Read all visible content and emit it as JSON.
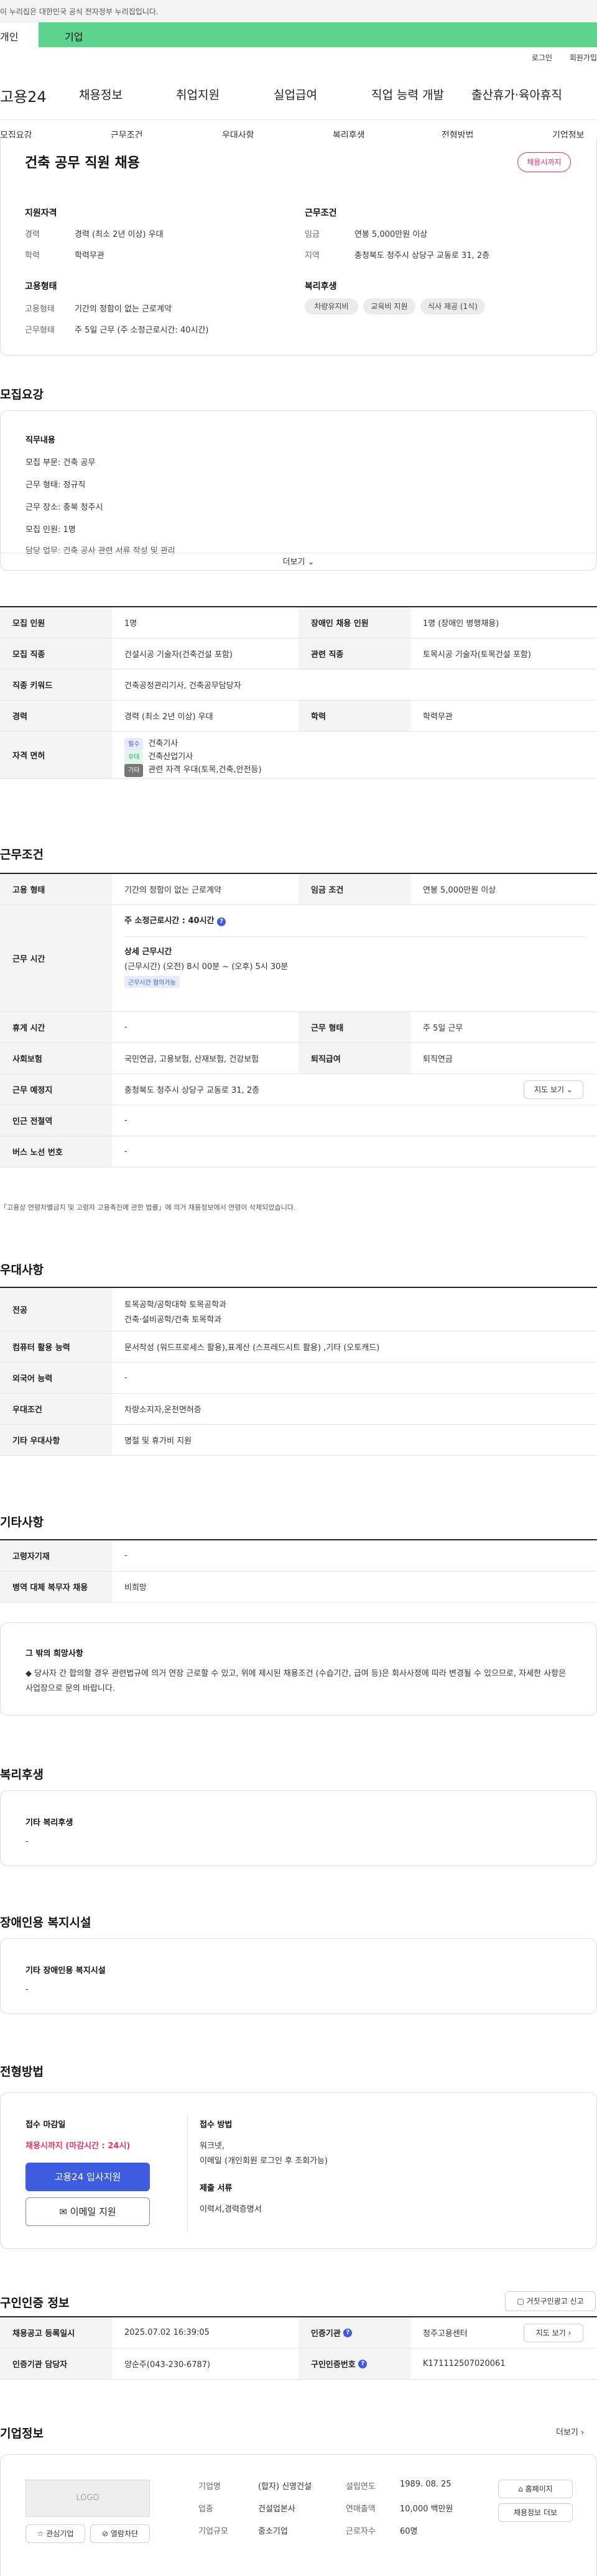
{
  "gov_banner": "이 누리집은 대한민국 공식 전자정부 누리집입니다.",
  "top_tabs": {
    "tab1": "개인",
    "tab2": "기업"
  },
  "util": {
    "login": "로그인",
    "join": "회원가입"
  },
  "header": {
    "brand": "고용24",
    "gnb": [
      "채용정보",
      "취업지원",
      "실업급여",
      "직업 능력 개발",
      "출산휴가·육아휴직"
    ]
  },
  "subnav": [
    "모집요강",
    "근무조건",
    "우대사항",
    "복리후생",
    "전형방법",
    "기업정보"
  ],
  "job": {
    "title": "건축 공무 직원 채용",
    "badge": "채용시까지",
    "qual": {
      "heading": "지원자격",
      "career_label": "경력",
      "career": "경력 (최소 2년 이상) 우대",
      "edu_label": "학력",
      "edu": "학력무관"
    },
    "cond": {
      "heading": "근무조건",
      "wage_label": "임금",
      "wage": "연봉 5,000만원 이상",
      "loc_label": "지역",
      "loc": "충청북도 청주시 상당구 교동로 31, 2층"
    },
    "emp": {
      "heading": "고용형태",
      "type_label": "고용형태",
      "type": "기간의 정함이 없는 근로계약",
      "hours_label": "근무형태",
      "hours": "주 5일 근무 (주 소정근로시간: 40시간)"
    },
    "welfare": {
      "heading": "복리후생",
      "chips": [
        "차량유지비",
        "교육비 지원",
        "식사 제공 (1식)"
      ]
    }
  },
  "recruit": {
    "title": "모집요강",
    "duty_heading": "직무내용",
    "lines": [
      "모집 부문: 건축 공무",
      "근무 형태: 정규직",
      "근무 장소: 충북 청주시",
      "모집 인원: 1명",
      "담당 업무: 건축 공사 관련 서류 작성 및 관리"
    ],
    "more": "더보기"
  },
  "recruit_table": {
    "count_label": "모집 인원",
    "count": "1명",
    "disabled_label": "장애인 채용 인원",
    "disabled": "1명 (장애인 병행채용)",
    "job_label": "모집 직종",
    "job": "건설시공 기술자(건축건설 포함)",
    "related_label": "관련 직종",
    "related": "토목시공 기술자(토목건설 포함)",
    "keyword_label": "직종 키워드",
    "keyword": "건축공정관리기사, 건축공무담당자",
    "career_label": "경력",
    "career": "경력 (최소 2년 이상) 우대",
    "edu_label": "학력",
    "edu": "학력무관",
    "license_label": "자격 면허",
    "licenses": [
      {
        "tag": "필수",
        "name": "건축기사"
      },
      {
        "tag": "우대",
        "name": "건축산업기사"
      },
      {
        "tag": "기타",
        "name": "관련 자격 우대(토목,건축,안전등)"
      }
    ]
  },
  "conditions": {
    "title": "근무조건",
    "type_label": "고용 형태",
    "type": "기간의 정함이 없는 근로계약",
    "wage_label": "임금 조건",
    "wage": "연봉 5,000만원 이상",
    "hours_label": "근무 시간",
    "hours_main": "주 소정근로시간 : 40시간",
    "hours_detail_heading": "상세 근무시간",
    "hours_detail": "(근무시간) (오전) 8시 00분 ~ (오후) 5시 30분",
    "hours_tag": "근무시간 협의가능",
    "break_label": "휴게 시간",
    "break": "-",
    "form_label": "근무 형태",
    "form": "주 5일 근무",
    "insurance_label": "사회보험",
    "insurance": "국민연금, 고용보험, 산재보험, 건강보험",
    "severance_label": "퇴직급여",
    "severance": "퇴직연금",
    "place_label": "근무 예정지",
    "place": "충청북도 청주시 상당구 교동로 31, 2층",
    "map_btn": "지도 보기",
    "station_label": "인근 전철역",
    "station": "-",
    "bus_label": "버스 노선 번호",
    "bus": "-",
    "footnote": "「고용상 연령차별금지 및 고령자 고용촉진에 관한 법률」에 의거 채용정보에서 연령이 삭제되었습니다."
  },
  "preference": {
    "title": "우대사항",
    "major_label": "전공",
    "major1": "토목공학/공학대학 토목공학과",
    "major2": "건축·설비공학/건축 토목학과",
    "computer_label": "컴퓨터 활용 능력",
    "computer": "문서작성 (워드프로세스 활용),표계산 (스프레드시트 활용) ,기타 (오토캐드)",
    "lang_label": "외국어 능력",
    "lang": "-",
    "cond_label": "우대조건",
    "cond": "차량소지자,운전면허증",
    "other_label": "기타 우대사항",
    "other": "명절 및 휴가비 지원"
  },
  "misc": {
    "title": "기타사항",
    "elderly_label": "고령자기재",
    "elderly": "-",
    "military_label": "병역 대체 복무자 채용",
    "military": "비희망",
    "extra_heading": "그 밖의 희망사항",
    "extra_text": "◆ 당사자 간 합의할 경우 관련법규에 의거 연장 근로할 수 있고, 위에 제시된 채용조건 (수습기간, 급여 등)은 회사사정에 따라 변경될 수 있으므로, 자세한 사항은 사업장으로 문의 바랍니다."
  },
  "welfare": {
    "title": "복리후생",
    "heading": "기타 복리후생",
    "value": "-"
  },
  "disability": {
    "title": "장애인용 복지시설",
    "heading": "기타 장애인용 복지시설",
    "value": "-"
  },
  "process": {
    "title": "전형방법",
    "deadline_label": "접수 마감일",
    "deadline": "채용시까지 (마감시간 : 24시)",
    "apply_btn": "고용24 입사지원",
    "email_btn": "이메일 지원",
    "method_heading": "접수 방법",
    "method1": "워크넷,",
    "method2": "이메일 (개인회원 로그인 후 조회가능)",
    "docs_heading": "제출 서류",
    "docs": "이력서,경력증명서"
  },
  "reg": {
    "title": "구인인증 정보",
    "report_btn": "거짓구인광고 신고",
    "date_label": "채용공고 등록일시",
    "date": "2025.07.02 16:39:05",
    "agency_label": "인증기관",
    "agency": "청주고용센터",
    "map_btn": "지도 보기",
    "manager_label": "인증기관 담당자",
    "manager": "양순주(043-230-6787)",
    "id_label": "구인인증번호",
    "id": "K171112507020061"
  },
  "company": {
    "title": "기업정보",
    "more": "더보기",
    "logo": "LOGO",
    "fav_btn": "관심기업",
    "block_btn": "열람차단",
    "name_label": "기업명",
    "name": "(합자) 신영건설",
    "founded_label": "설립연도",
    "founded": "1989. 08. 25",
    "industry_label": "업종",
    "industry": "건설업본사",
    "sales_label": "연매출액",
    "sales": "10,000 백만원",
    "size_label": "기업규모",
    "size": "중소기업",
    "staff_label": "근로자수",
    "staff": "60명",
    "home_btn": "홈페이지",
    "list_btn": "채용정보 더보"
  }
}
